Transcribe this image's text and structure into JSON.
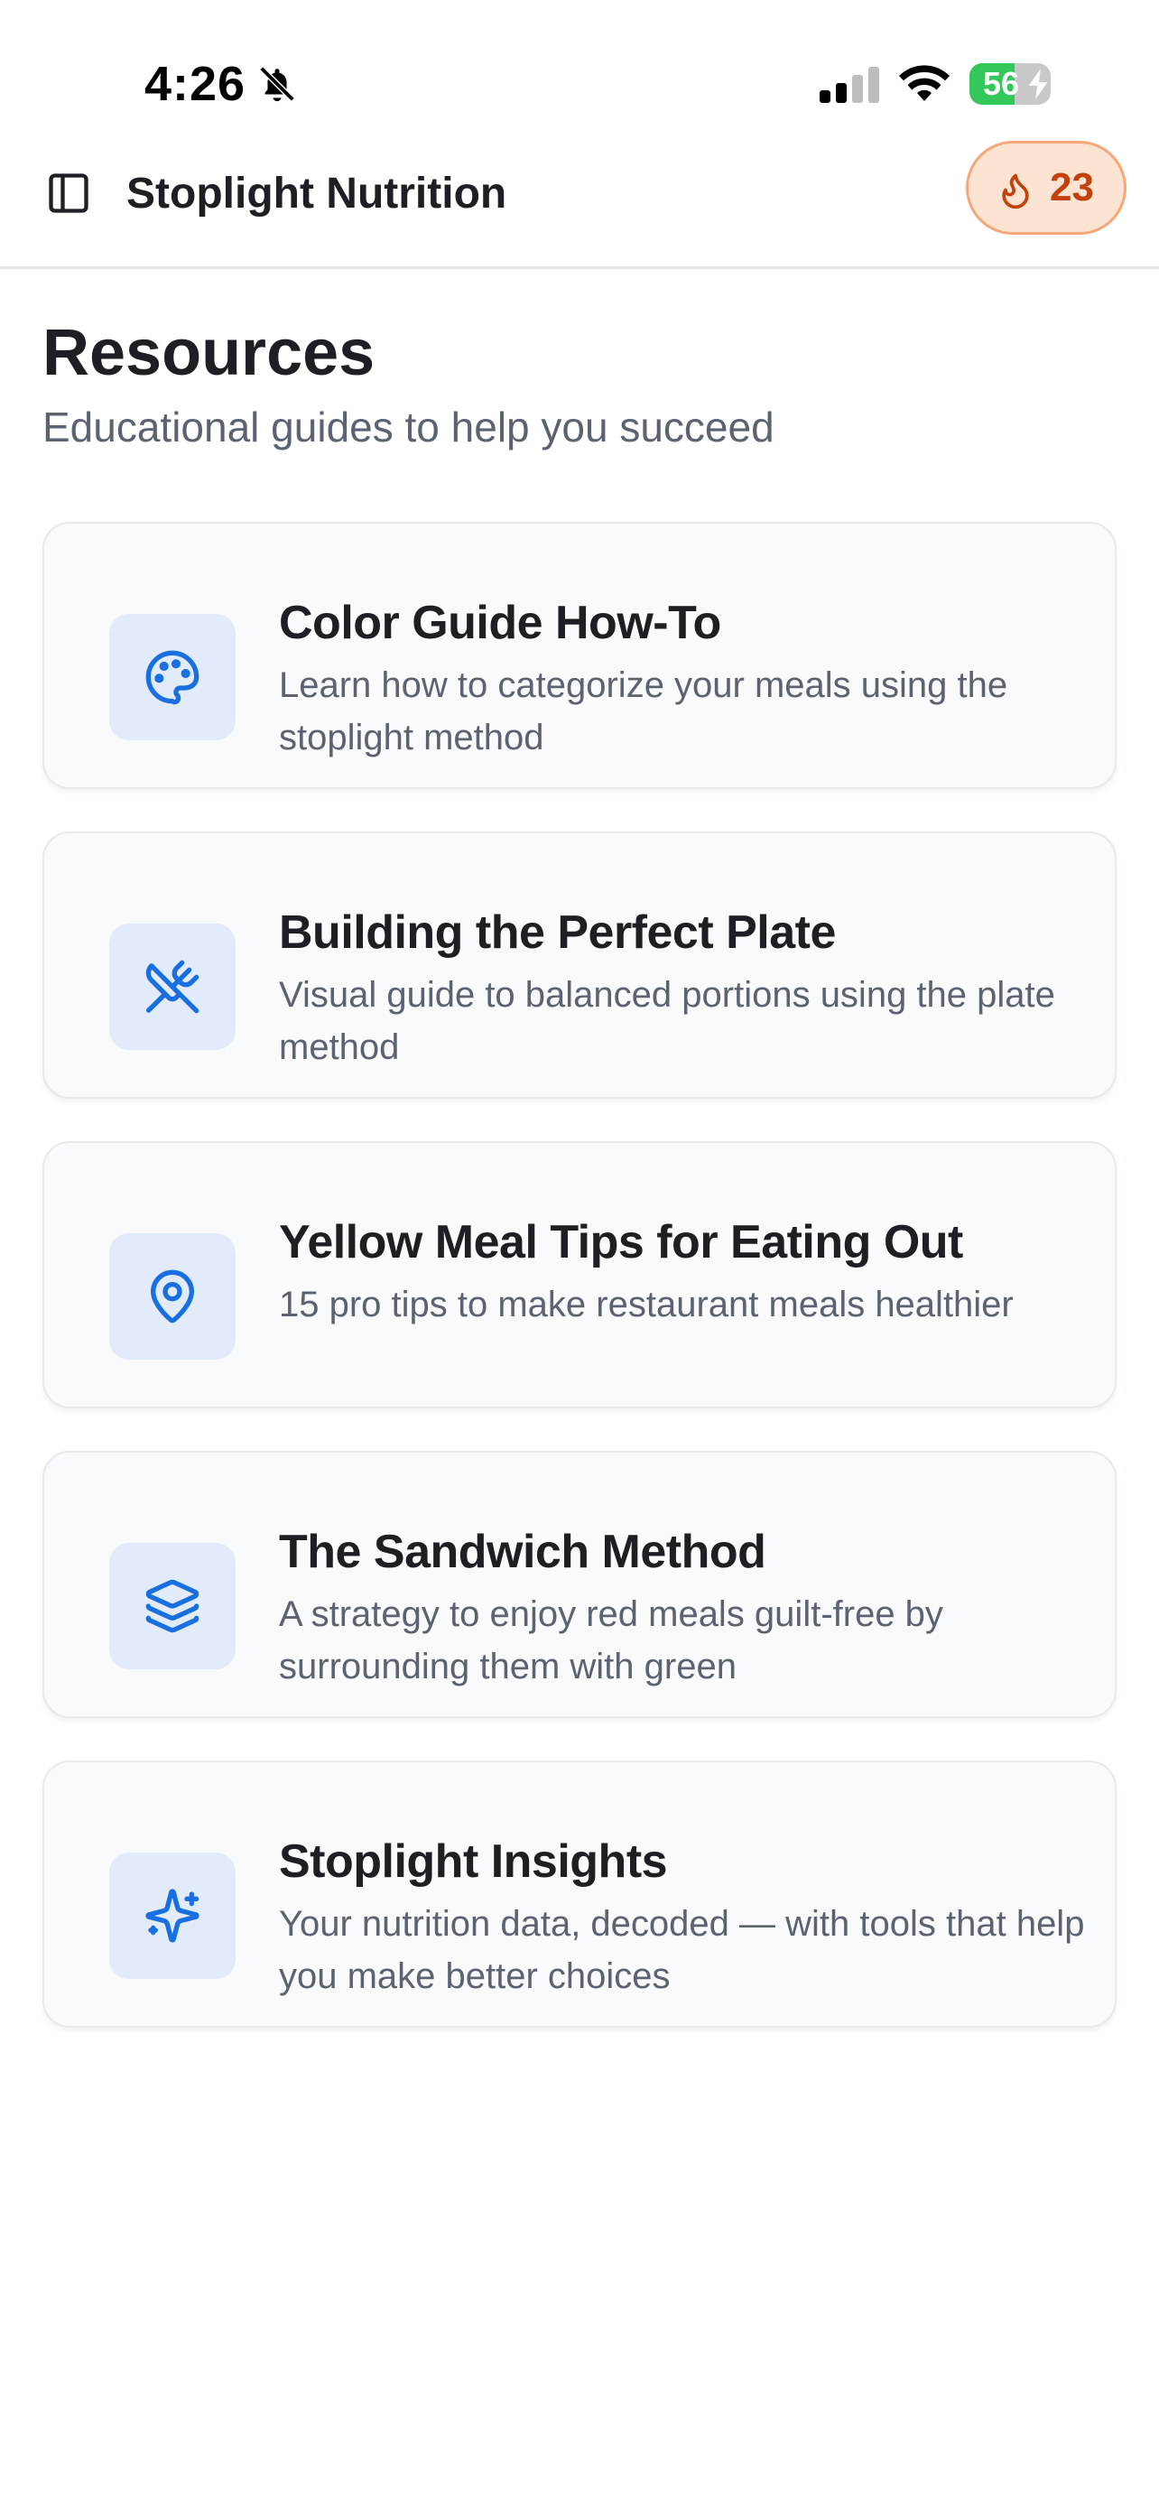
{
  "status_bar": {
    "time": "4:26",
    "battery_percent": 56,
    "battery_text": "56",
    "icons": [
      "bell-slash-icon",
      "cellular-signal-icon",
      "wifi-icon",
      "battery-charging-icon"
    ]
  },
  "header": {
    "title": "Stoplight Nutrition",
    "streak_count": "23",
    "icons": [
      "sidebar-toggle-icon",
      "flame-icon"
    ]
  },
  "page": {
    "title": "Resources",
    "subtitle": "Educational guides to help you succeed"
  },
  "resources": [
    {
      "title": "Color Guide How-To",
      "description": "Learn how to categorize your meals using the stoplight method",
      "icon": "palette-icon"
    },
    {
      "title": "Building the Perfect Plate",
      "description": "Visual guide to balanced portions using the plate method",
      "icon": "utensils-crossed-icon"
    },
    {
      "title": "Yellow Meal Tips for Eating Out",
      "description": "15 pro tips to make restaurant meals healthier",
      "icon": "map-pin-icon"
    },
    {
      "title": "The Sandwich Method",
      "description": "A strategy to enjoy red meals guilt-free by surrounding them with green",
      "icon": "layers-icon"
    },
    {
      "title": "Stoplight Insights",
      "description": "Your nutrition data, decoded — with tools that help you make better choices",
      "icon": "sparkles-icon"
    }
  ],
  "colors": {
    "accent_blue": "#1a6fe0",
    "icon_box": "#e1ebfa",
    "streak_bg": "#fde3d2",
    "streak_text": "#c2410c",
    "battery_green": "#34c759"
  }
}
